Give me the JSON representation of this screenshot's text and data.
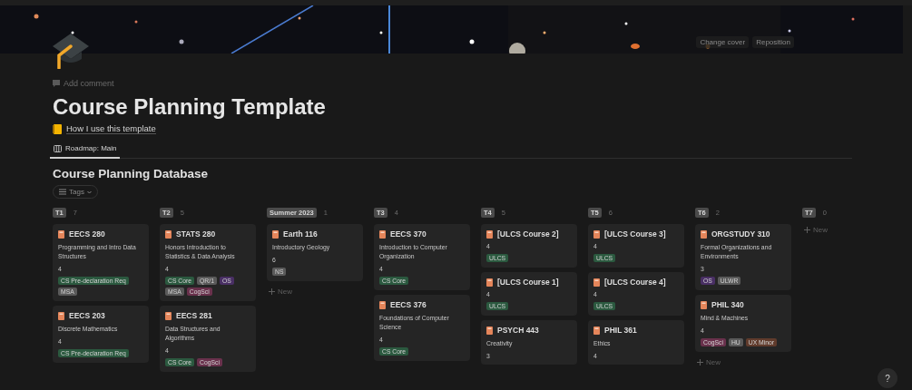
{
  "cover": {
    "actions": [
      "Change cover",
      "Reposition"
    ]
  },
  "comment": "Add comment",
  "title": "Course Planning Template",
  "link": "How I use this template",
  "views": [
    {
      "label": "Roadmap: Main",
      "selected": true
    }
  ],
  "database": {
    "title": "Course Planning Database",
    "filter": "Tags"
  },
  "columns": [
    {
      "name": "T1",
      "count": "7",
      "cards": [
        {
          "title": "EECS 280",
          "description": "Programming and Intro Data Structures",
          "credits": "4",
          "tags": [
            {
              "label": "CS Pre-declaration Req",
              "color": "#2b593f"
            },
            {
              "label": "MSA",
              "color": "#5a5a5a"
            }
          ]
        },
        {
          "title": "EECS 203",
          "description": "Discrete Mathematics",
          "credits": "4",
          "tags": [
            {
              "label": "CS Pre-declaration Req",
              "color": "#2b593f"
            }
          ]
        }
      ]
    },
    {
      "name": "T2",
      "count": "5",
      "cards": [
        {
          "title": "STATS 280",
          "description": "Honors Introduction to Statistics & Data Analysis",
          "credits": "4",
          "tags": [
            {
              "label": "CS Core",
              "color": "#2b593f"
            },
            {
              "label": "QR/1",
              "color": "#5a5a5a"
            },
            {
              "label": "OS",
              "color": "#492f64"
            },
            {
              "label": "MSA",
              "color": "#5a5a5a"
            },
            {
              "label": "CogSci",
              "color": "#69314c"
            }
          ]
        },
        {
          "title": "EECS 281",
          "description": "Data Structures and Algorithms",
          "credits": "4",
          "tags": [
            {
              "label": "CS Core",
              "color": "#2b593f"
            },
            {
              "label": "CogSci",
              "color": "#69314c"
            }
          ]
        }
      ]
    },
    {
      "name": "Summer 2023",
      "count": "1",
      "new": "New",
      "cards": [
        {
          "title": "Earth 116",
          "description": "Introductory Geology",
          "credits": "6",
          "tags": [
            {
              "label": "NS",
              "color": "#5a5a5a"
            }
          ]
        }
      ]
    },
    {
      "name": "T3",
      "count": "4",
      "cards": [
        {
          "title": "EECS 370",
          "description": "Introduction to Computer Organization",
          "credits": "4",
          "tags": [
            {
              "label": "CS Core",
              "color": "#2b593f"
            }
          ]
        },
        {
          "title": "EECS 376",
          "description": "Foundations of Computer Science",
          "credits": "4",
          "tags": [
            {
              "label": "CS Core",
              "color": "#2b593f"
            }
          ]
        }
      ]
    },
    {
      "name": "T4",
      "count": "5",
      "cards": [
        {
          "title": "[ULCS Course 2]",
          "credits": "4",
          "tags": [
            {
              "label": "ULCS",
              "color": "#2b593f"
            }
          ]
        },
        {
          "title": "[ULCS Course 1]",
          "credits": "4",
          "tags": [
            {
              "label": "ULCS",
              "color": "#2b593f"
            }
          ]
        },
        {
          "title": "PSYCH 443",
          "description": "Creativity",
          "credits": "3"
        }
      ]
    },
    {
      "name": "T5",
      "count": "6",
      "cards": [
        {
          "title": "[ULCS Course 3]",
          "credits": "4",
          "tags": [
            {
              "label": "ULCS",
              "color": "#2b593f"
            }
          ]
        },
        {
          "title": "[ULCS Course 4]",
          "credits": "4",
          "tags": [
            {
              "label": "ULCS",
              "color": "#2b593f"
            }
          ]
        },
        {
          "title": "PHIL 361",
          "description": "Ethics",
          "credits": "4"
        }
      ]
    },
    {
      "name": "T6",
      "count": "2",
      "new": "New",
      "cards": [
        {
          "title": "ORGSTUDY 310",
          "description": "Formal Organizations and Environments",
          "credits": "3",
          "tags": [
            {
              "label": "OS",
              "color": "#492f64"
            },
            {
              "label": "ULWR",
              "color": "#5a5a5a"
            }
          ]
        },
        {
          "title": "PHIL 340",
          "description": "Mind & Machines",
          "credits": "4",
          "tags": [
            {
              "label": "CogSci",
              "color": "#69314c"
            },
            {
              "label": "HU",
              "color": "#5a5a5a"
            },
            {
              "label": "UX Minor",
              "color": "#603b2c"
            }
          ]
        }
      ]
    },
    {
      "name": "T7",
      "count": "0",
      "new": "New"
    }
  ],
  "help": "?"
}
